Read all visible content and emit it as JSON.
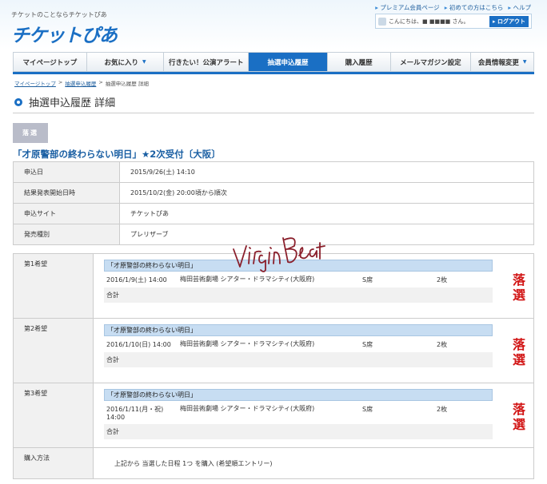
{
  "header": {
    "tagline": "チケットのことならチケットぴあ",
    "logo": "チケットぴあ",
    "links": [
      "プレミアム会員ページ",
      "初めての方はこちら",
      "ヘルプ"
    ],
    "greeting": "こんにちは、■ ■■■■ さん。",
    "logout": "ログアウト"
  },
  "nav": [
    {
      "label": "マイページトップ",
      "caret": false,
      "active": false,
      "w": 92
    },
    {
      "label": "お気に入り",
      "caret": true,
      "active": false,
      "w": 97
    },
    {
      "label": "行きたい！公演アラート",
      "caret": false,
      "active": false,
      "w": 106
    },
    {
      "label": "抽選申込履歴",
      "caret": false,
      "active": true,
      "w": 99
    },
    {
      "label": "購入履歴",
      "caret": false,
      "active": false,
      "w": 79
    },
    {
      "label": "メールマガジン設定",
      "caret": false,
      "active": false,
      "w": 101
    },
    {
      "label": "会員情報変更",
      "caret": true,
      "active": false,
      "w": 78
    }
  ],
  "breadcrumb": [
    "マイページトップ",
    "抽選申込履歴",
    "抽選申込履歴 詳細"
  ],
  "page_title": "抽選申込履歴 詳細",
  "status_badge": "落選",
  "event_title": "「才原警部の終わらない明日」★2次受付〔大阪〕",
  "info": [
    {
      "k": "申込日",
      "v": "2015/9/26(土) 14:10"
    },
    {
      "k": "結果発表開始日時",
      "v": "2015/10/2(金) 20:00頃から順次"
    },
    {
      "k": "申込サイト",
      "v": "チケットぴあ"
    },
    {
      "k": "発売種別",
      "v": "プレリザーブ"
    }
  ],
  "wishes": [
    {
      "label": "第1希望",
      "performance": "「才原警部の終わらない明日」",
      "date": "2016/1/9(土) 14:00",
      "venue": "梅田芸術劇場 シアター・ドラマシティ(大阪府)",
      "seat": "S席",
      "qty": "2枚",
      "total_label": "合計",
      "result": "落選"
    },
    {
      "label": "第2希望",
      "performance": "「才原警部の終わらない明日」",
      "date": "2016/1/10(日) 14:00",
      "venue": "梅田芸術劇場 シアター・ドラマシティ(大阪府)",
      "seat": "S席",
      "qty": "2枚",
      "total_label": "合計",
      "result": "落選"
    },
    {
      "label": "第3希望",
      "performance": "「才原警部の終わらない明日」",
      "date": "2016/1/11(月・祝) 14:00",
      "venue": "梅田芸術劇場 シアター・ドラマシティ(大阪府)",
      "seat": "S席",
      "qty": "2枚",
      "total_label": "合計",
      "result": "落選"
    }
  ],
  "purchase": {
    "label": "購入方法",
    "text": "上記から 当選した日程 1つ を購入 (希望順エントリー)"
  },
  "watermark": "VirginBeat",
  "colors": {
    "accent": "#1a6fc4",
    "result_red": "#d21616"
  }
}
